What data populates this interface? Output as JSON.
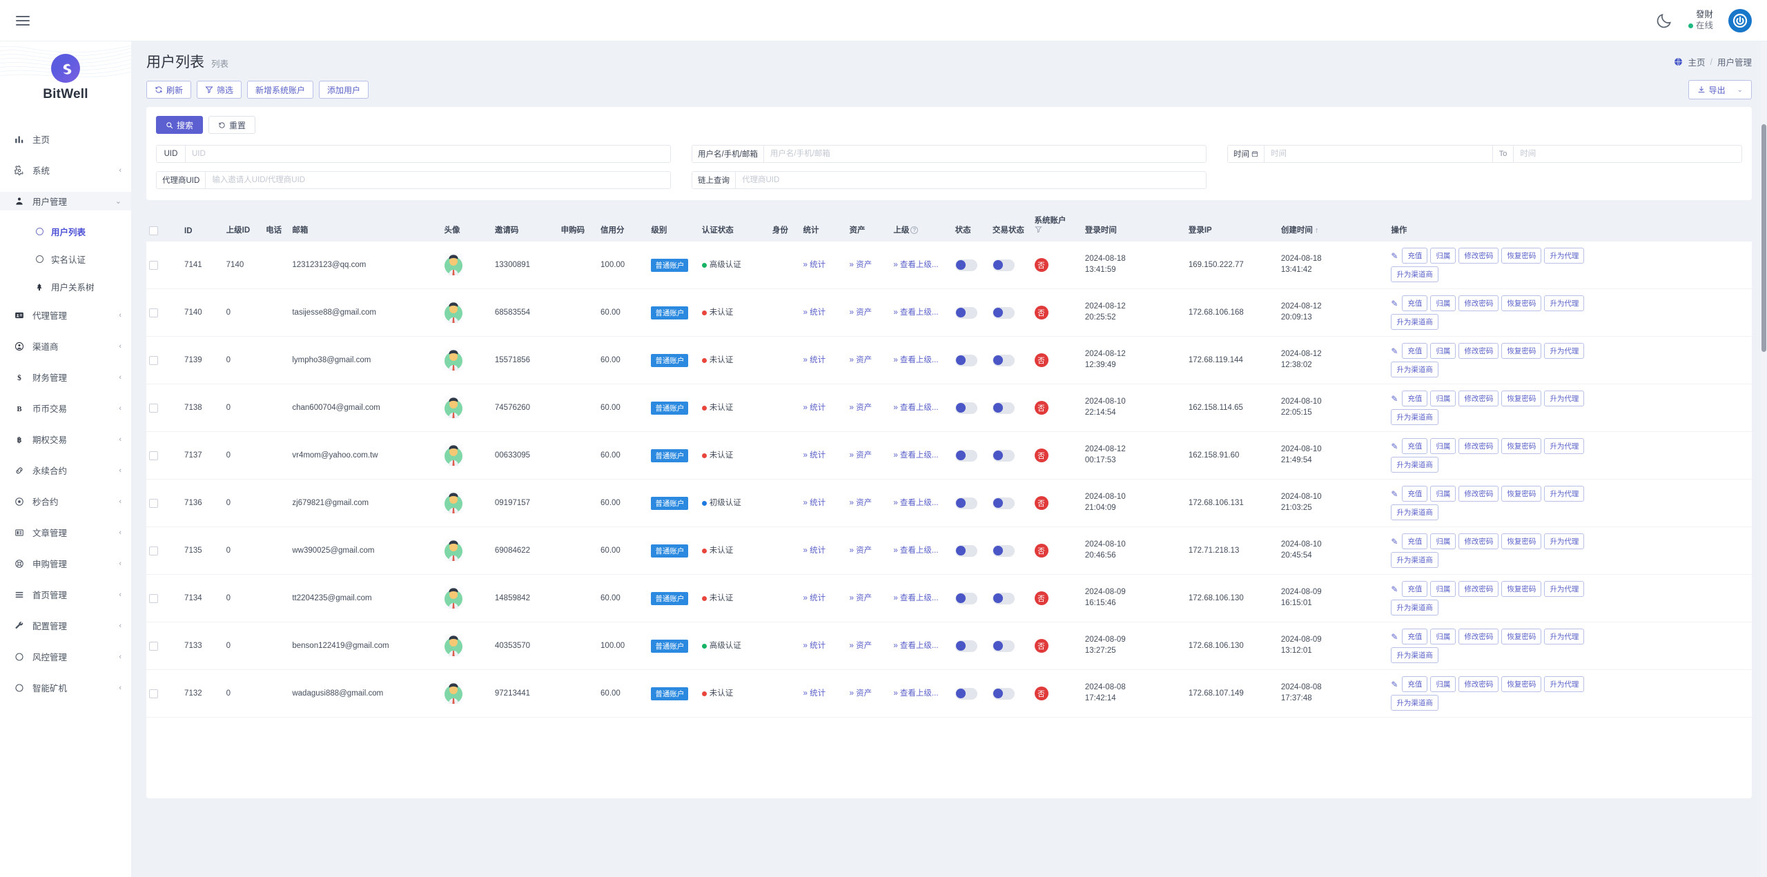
{
  "topbar": {
    "menu_icon": "hamburger-icon",
    "theme_icon": "moon-icon",
    "user_name": "發財",
    "user_status": "在线",
    "avatar_icon": "power-avatar-icon"
  },
  "sidebar": {
    "brand": "BitWell",
    "items": [
      {
        "label": "主页",
        "icon": "chart-bars-icon",
        "chevron": "",
        "active": false
      },
      {
        "label": "系统",
        "icon": "gear-icon",
        "chevron": "‹",
        "active": false
      },
      {
        "label": "用户管理",
        "icon": "user-manage-icon",
        "chevron": "⌄",
        "active": true
      },
      {
        "label": "代理管理",
        "icon": "id-card-icon",
        "chevron": "‹",
        "active": false
      },
      {
        "label": "渠道商",
        "icon": "user-circle-icon",
        "chevron": "‹",
        "active": false
      },
      {
        "label": "财务管理",
        "icon": "dollar-icon",
        "chevron": "‹",
        "active": false
      },
      {
        "label": "币币交易",
        "icon": "bitcoin-b-icon",
        "chevron": "‹",
        "active": false
      },
      {
        "label": "期权交易",
        "icon": "bitcoin-icon",
        "chevron": "‹",
        "active": false
      },
      {
        "label": "永续合约",
        "icon": "link-chain-icon",
        "chevron": "‹",
        "active": false
      },
      {
        "label": "秒合约",
        "icon": "target-dot-icon",
        "chevron": "‹",
        "active": false
      },
      {
        "label": "文章管理",
        "icon": "newspaper-icon",
        "chevron": "‹",
        "active": false
      },
      {
        "label": "申购管理",
        "icon": "lifebuoy-icon",
        "chevron": "‹",
        "active": false
      },
      {
        "label": "首页管理",
        "icon": "list-lines-icon",
        "chevron": "‹",
        "active": false
      },
      {
        "label": "配置管理",
        "icon": "wrench-icon",
        "chevron": "‹",
        "active": false
      },
      {
        "label": "风控管理",
        "icon": "circle-icon",
        "chevron": "‹",
        "active": false
      },
      {
        "label": "智能矿机",
        "icon": "circle-icon",
        "chevron": "‹",
        "active": false
      }
    ],
    "subitems": [
      {
        "label": "用户列表",
        "icon": "circle-icon",
        "selected": true
      },
      {
        "label": "实名认证",
        "icon": "circle-icon",
        "selected": false
      },
      {
        "label": "用户关系树",
        "icon": "tree-icon",
        "selected": false
      }
    ]
  },
  "page": {
    "title": "用户列表",
    "subtitle": "列表",
    "breadcrumb_home": "主页",
    "breadcrumb_sep": "/",
    "breadcrumb_current": "用户管理"
  },
  "toolbar": {
    "refresh": "刷新",
    "filter": "筛选",
    "add_system_account": "新增系统账户",
    "add_user": "添加用户",
    "export": "导出"
  },
  "search": {
    "search_btn": "搜索",
    "reset_btn": "重置",
    "fields": [
      {
        "label": "UID",
        "value": "",
        "placeholder": "UID"
      },
      {
        "label": "用户名/手机/邮箱",
        "value": "",
        "placeholder": "用户名/手机/邮箱"
      },
      {
        "label": "时间",
        "value": "",
        "placeholder": "时间",
        "mid": "To",
        "value2": "",
        "placeholder2": "时间",
        "range": true
      },
      {
        "label": "代理商UID",
        "value": "",
        "placeholder": "输入邀请人UID/代理商UID"
      },
      {
        "label": "链上查询",
        "value": "",
        "placeholder": "代理商UID"
      }
    ]
  },
  "table": {
    "columns": [
      "ID",
      "上级ID",
      "电话",
      "邮箱",
      "头像",
      "邀请码",
      "申购码",
      "信用分",
      "级别",
      "认证状态",
      "身份",
      "统计",
      "资产",
      "上级",
      "状态",
      "交易状态",
      "系统账户",
      "登录时间",
      "登录IP",
      "创建时间",
      "操作"
    ],
    "sort_col": "创建时间",
    "sort_dir": "↑",
    "level_tag": "普通账户",
    "stat_link": "» 统计",
    "asset_link": "» 资产",
    "parent_link": "» 查看上级...",
    "sys_no": "否",
    "ops": [
      "充值",
      "归属",
      "修改密码",
      "恢复密码",
      "升为代理",
      "升为渠道商"
    ],
    "rows": [
      {
        "id": "7141",
        "pid": "7140",
        "phone": "",
        "email": "123123123@qq.com",
        "invite": "13300891",
        "buy_code": "",
        "credit": "100.00",
        "cert": "高级认证",
        "cert_color": "green",
        "login_time": "2024-08-18 13:41:59",
        "ip": "169.150.222.77",
        "created": "2024-08-18 13:41:42"
      },
      {
        "id": "7140",
        "pid": "0",
        "phone": "",
        "email": "tasijesse88@gmail.com",
        "invite": "68583554",
        "buy_code": "",
        "credit": "60.00",
        "cert": "未认证",
        "cert_color": "red",
        "login_time": "2024-08-12 20:25:52",
        "ip": "172.68.106.168",
        "created": "2024-08-12 20:09:13"
      },
      {
        "id": "7139",
        "pid": "0",
        "phone": "",
        "email": "lympho38@gmail.com",
        "invite": "15571856",
        "buy_code": "",
        "credit": "60.00",
        "cert": "未认证",
        "cert_color": "red",
        "login_time": "2024-08-12 12:39:49",
        "ip": "172.68.119.144",
        "created": "2024-08-12 12:38:02"
      },
      {
        "id": "7138",
        "pid": "0",
        "phone": "",
        "email": "chan600704@gmail.com",
        "invite": "74576260",
        "buy_code": "",
        "credit": "60.00",
        "cert": "未认证",
        "cert_color": "red",
        "login_time": "2024-08-10 22:14:54",
        "ip": "162.158.114.65",
        "created": "2024-08-10 22:05:15"
      },
      {
        "id": "7137",
        "pid": "0",
        "phone": "",
        "email": "vr4mom@yahoo.com.tw",
        "invite": "00633095",
        "buy_code": "",
        "credit": "60.00",
        "cert": "未认证",
        "cert_color": "red",
        "login_time": "2024-08-12 00:17:53",
        "ip": "162.158.91.60",
        "created": "2024-08-10 21:49:54"
      },
      {
        "id": "7136",
        "pid": "0",
        "phone": "",
        "email": "zj679821@gmail.com",
        "invite": "09197157",
        "buy_code": "",
        "credit": "60.00",
        "cert": "初级认证",
        "cert_color": "blue",
        "login_time": "2024-08-10 21:04:09",
        "ip": "172.68.106.131",
        "created": "2024-08-10 21:03:25"
      },
      {
        "id": "7135",
        "pid": "0",
        "phone": "",
        "email": "ww390025@gmail.com",
        "invite": "69084622",
        "buy_code": "",
        "credit": "60.00",
        "cert": "未认证",
        "cert_color": "red",
        "login_time": "2024-08-10 20:46:56",
        "ip": "172.71.218.13",
        "created": "2024-08-10 20:45:54"
      },
      {
        "id": "7134",
        "pid": "0",
        "phone": "",
        "email": "tt2204235@gmail.com",
        "invite": "14859842",
        "buy_code": "",
        "credit": "60.00",
        "cert": "未认证",
        "cert_color": "red",
        "login_time": "2024-08-09 16:15:46",
        "ip": "172.68.106.130",
        "created": "2024-08-09 16:15:01"
      },
      {
        "id": "7133",
        "pid": "0",
        "phone": "",
        "email": "benson122419@gmail.com",
        "invite": "40353570",
        "buy_code": "",
        "credit": "100.00",
        "cert": "高级认证",
        "cert_color": "green",
        "login_time": "2024-08-09 13:27:25",
        "ip": "172.68.106.130",
        "created": "2024-08-09 13:12:01"
      },
      {
        "id": "7132",
        "pid": "0",
        "phone": "",
        "email": "wadagusi888@gmail.com",
        "invite": "97213441",
        "buy_code": "",
        "credit": "60.00",
        "cert": "未认证",
        "cert_color": "red",
        "login_time": "2024-08-08 17:42:14",
        "ip": "172.68.107.149",
        "created": "2024-08-08 17:37:48"
      }
    ]
  }
}
